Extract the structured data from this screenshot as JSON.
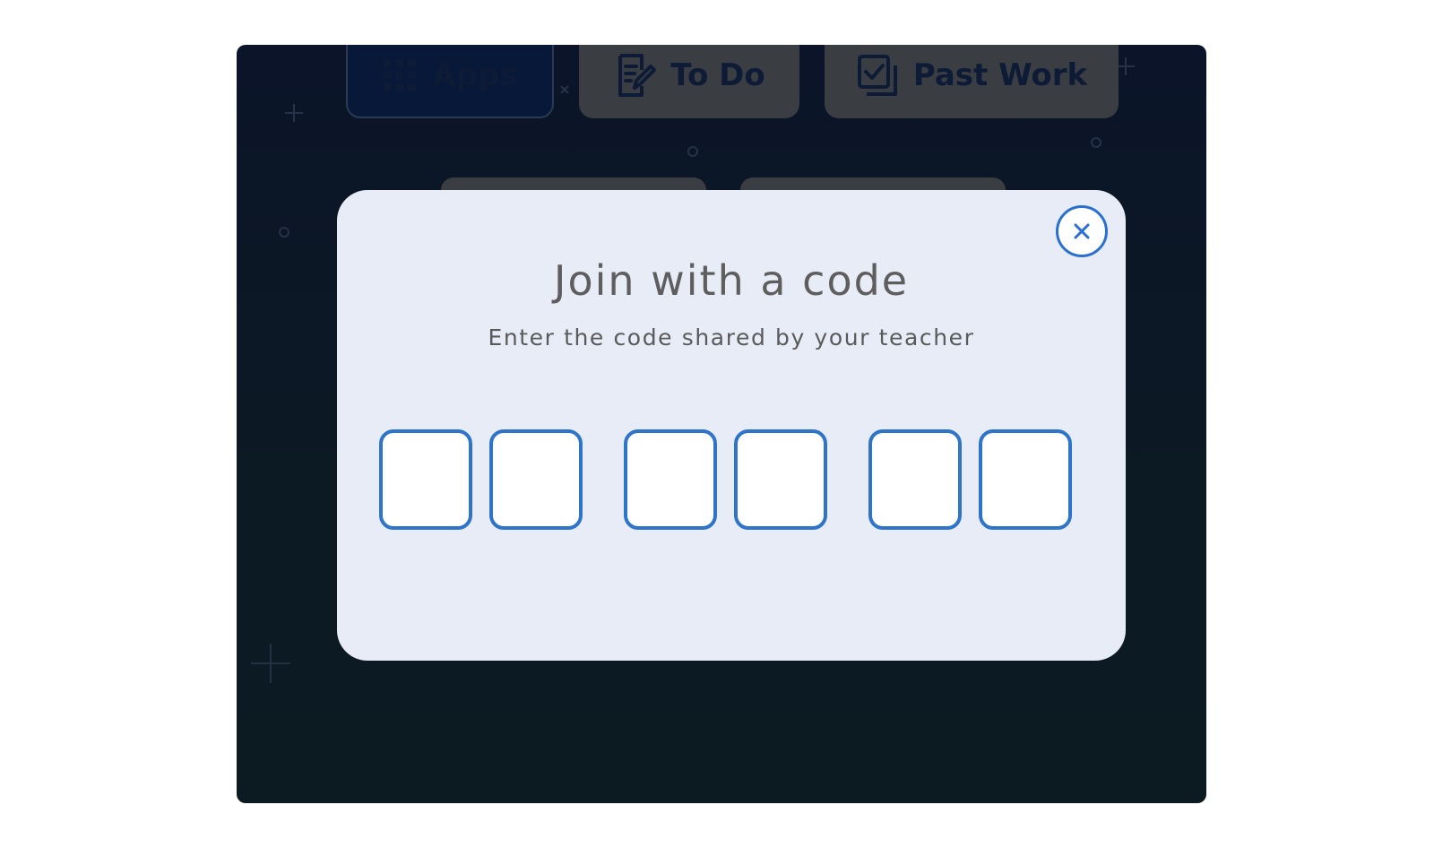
{
  "tabs": [
    {
      "label": "Apps",
      "icon": "grid-icon"
    },
    {
      "label": "To Do",
      "icon": "edit-note-icon"
    },
    {
      "label": "Past Work",
      "icon": "checked-stack-icon"
    }
  ],
  "modal": {
    "title": "Join with a code",
    "subtitle": "Enter the code shared by your teacher",
    "close_icon": "close-icon",
    "code_length": 6,
    "code_values": [
      "",
      "",
      "",
      "",
      "",
      ""
    ]
  },
  "colors": {
    "accent": "#2e75c9",
    "modal_bg": "#e7ecf6",
    "backdrop": "#0b1428"
  }
}
